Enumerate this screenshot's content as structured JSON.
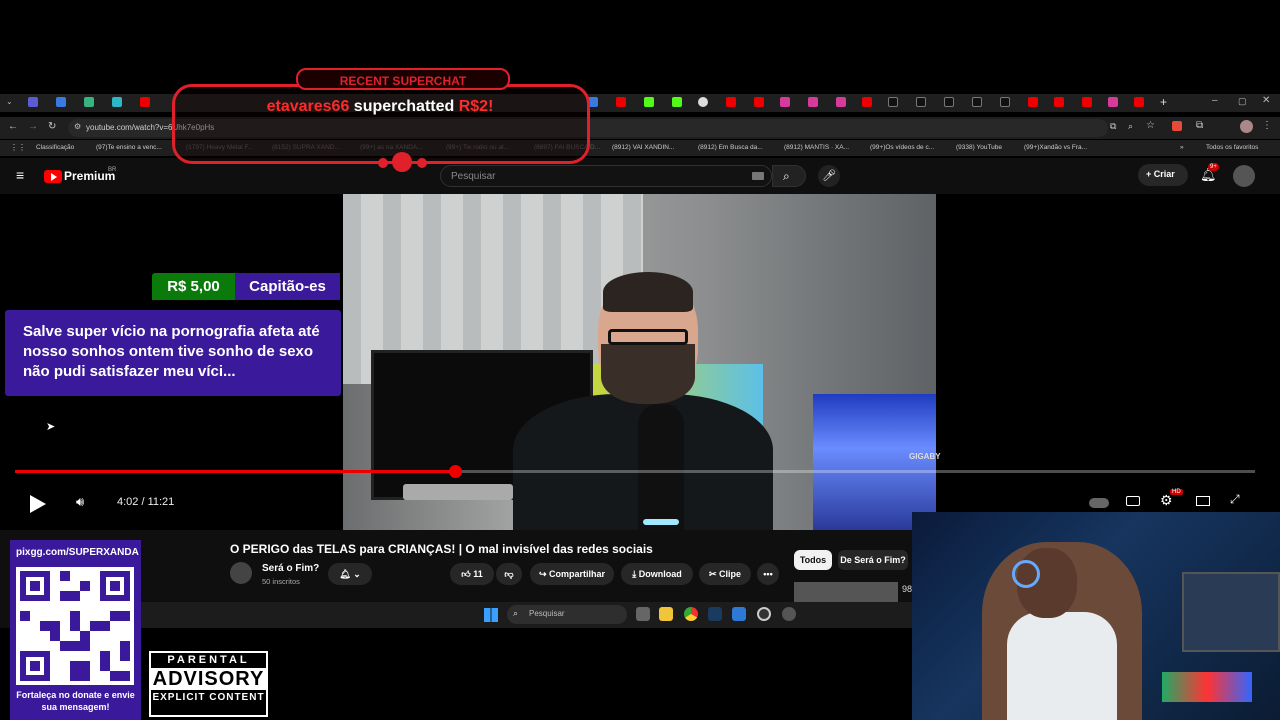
{
  "browser": {
    "url": "youtube.com/watch?v=6Uhk7e0pHs",
    "bookmarks": [
      "Classificação",
      "(97)Te ensino a venc...",
      "(1797) Heavy Metal F...",
      "(8152) SUPRA XAND...",
      "(99+) as na XANDA...",
      "(99+) Tw rodio ou al...",
      "(8897) FAI BUSCA D...",
      "(8912) VAI XANDIN...",
      "(8912) Em Busca da...",
      "(8912) MANTIS · XA...",
      "(99+)Os vídeos de c...",
      "(9338) YouTube",
      "(99+)Xandão vs Fra..."
    ],
    "all_favorites": "Todos os favoritos"
  },
  "youtube": {
    "brand": "Premium",
    "region": "BR",
    "search_placeholder": "Pesquisar",
    "create_label": "Criar",
    "notif_badge": "9+"
  },
  "player": {
    "time": "4:02 / 11:21",
    "progress": 0.355,
    "hd_badge": "HD",
    "brand_text": "GIGABY"
  },
  "superchat": {
    "amount": "R$ 5,00",
    "name": "Capitão-es",
    "message": "Salve super vício na pornografia afeta até nosso sonhos ontem tive sonho de sexo não pudi satisfazer meu víci..."
  },
  "recent_superchat": {
    "title": "RECENT SUPERCHAT",
    "donor": "etavares66",
    "action": "superchatted",
    "amount": "R$2!"
  },
  "video": {
    "title": "O PERIGO das TELAS para CRIANÇAS! | O mal invisível das redes sociais",
    "channel": "Será o Fim?",
    "subscribers": "50 inscritos",
    "likes": "11",
    "share": "Compartilhar",
    "download": "Download",
    "clip": "Clipe",
    "more": "•••"
  },
  "recommendations": {
    "chip_all": "Todos",
    "chip_channel": "De Será o Fim?",
    "thumb_num": "98"
  },
  "taskbar": {
    "search_placeholder": "Pesquisar"
  },
  "donate_panel": {
    "url": "pixgg.com/SUPERXANDA",
    "caption": "Fortaleça no donate e envie sua mensagem!"
  },
  "parental_advisory": {
    "line1": "PARENTAL",
    "line2": "ADVISORY",
    "line3": "EXPLICIT CONTENT"
  },
  "colors": {
    "youtube_red": "#ff0000",
    "superchat_green": "#0a7a0a",
    "superchat_purple": "#3a1a9a",
    "overlay_red": "#e0202a"
  }
}
